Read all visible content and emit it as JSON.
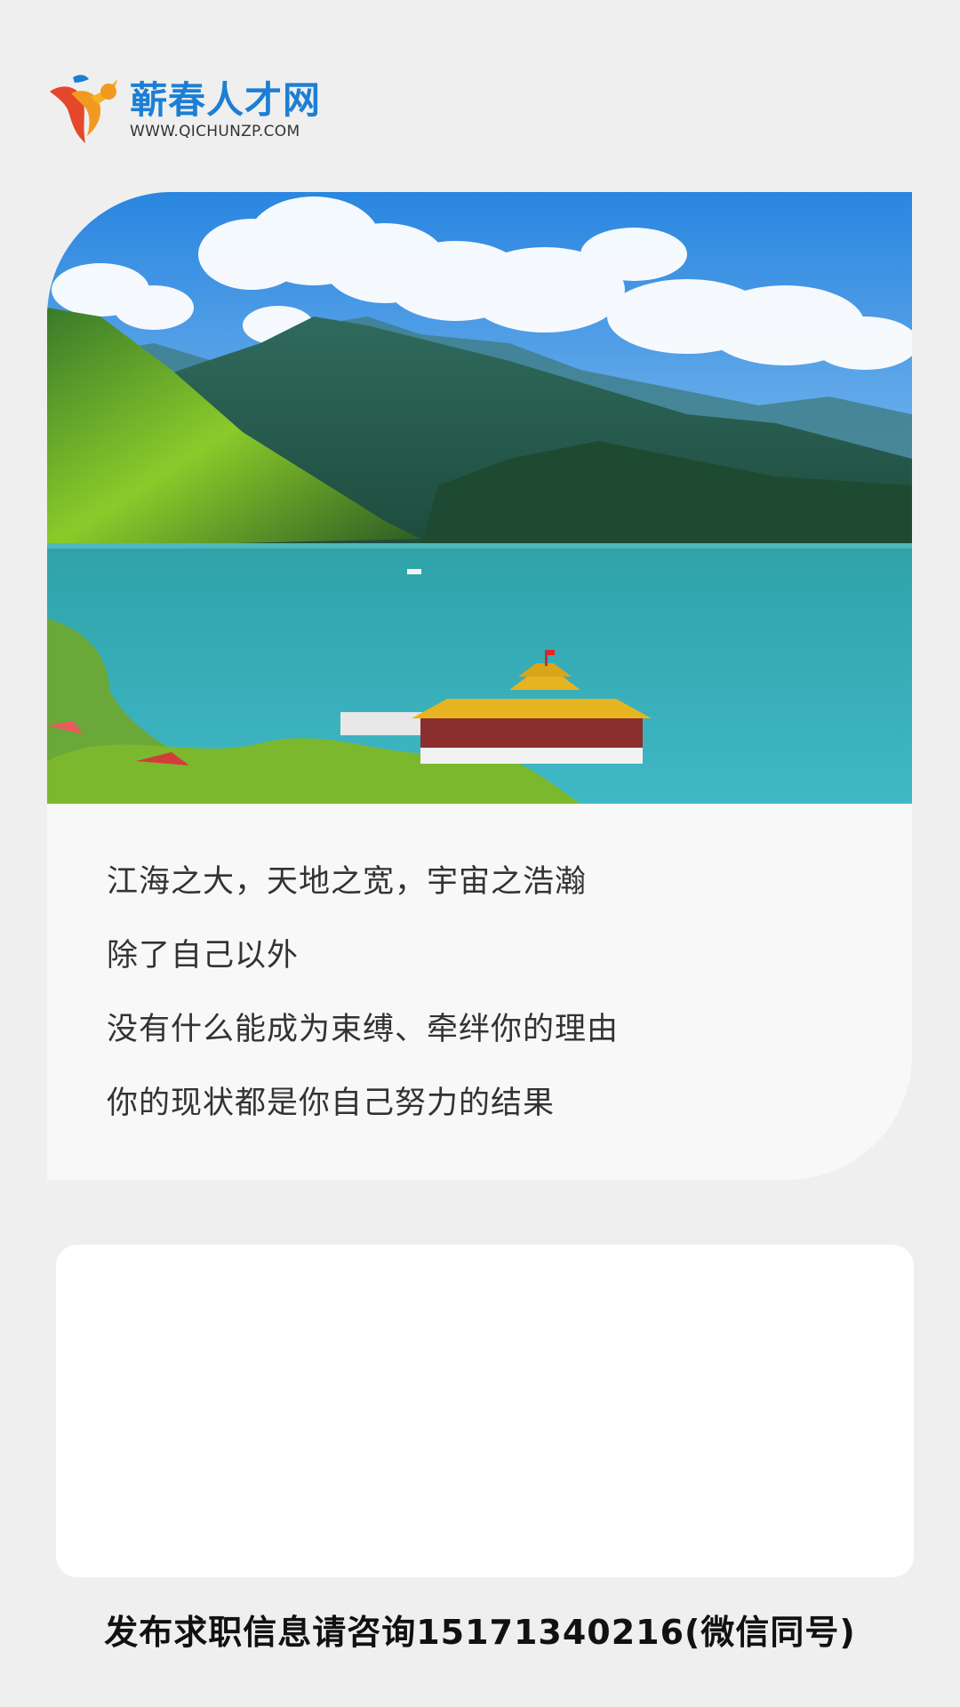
{
  "logo": {
    "name": "蕲春人才网",
    "url": "WWW.QICHUNZP.COM"
  },
  "quote": {
    "lines": [
      "江海之大，天地之宽，宇宙之浩瀚",
      "除了自己以外",
      "没有什么能成为束缚、牵绊你的理由",
      "你的现状都是你自己努力的结果"
    ]
  },
  "footer": {
    "text": "发布求职信息请咨询15171340216(微信同号)"
  },
  "colors": {
    "brand_blue": "#1d7fd3",
    "brand_orange": "#f08a1c",
    "background": "#efefef"
  }
}
